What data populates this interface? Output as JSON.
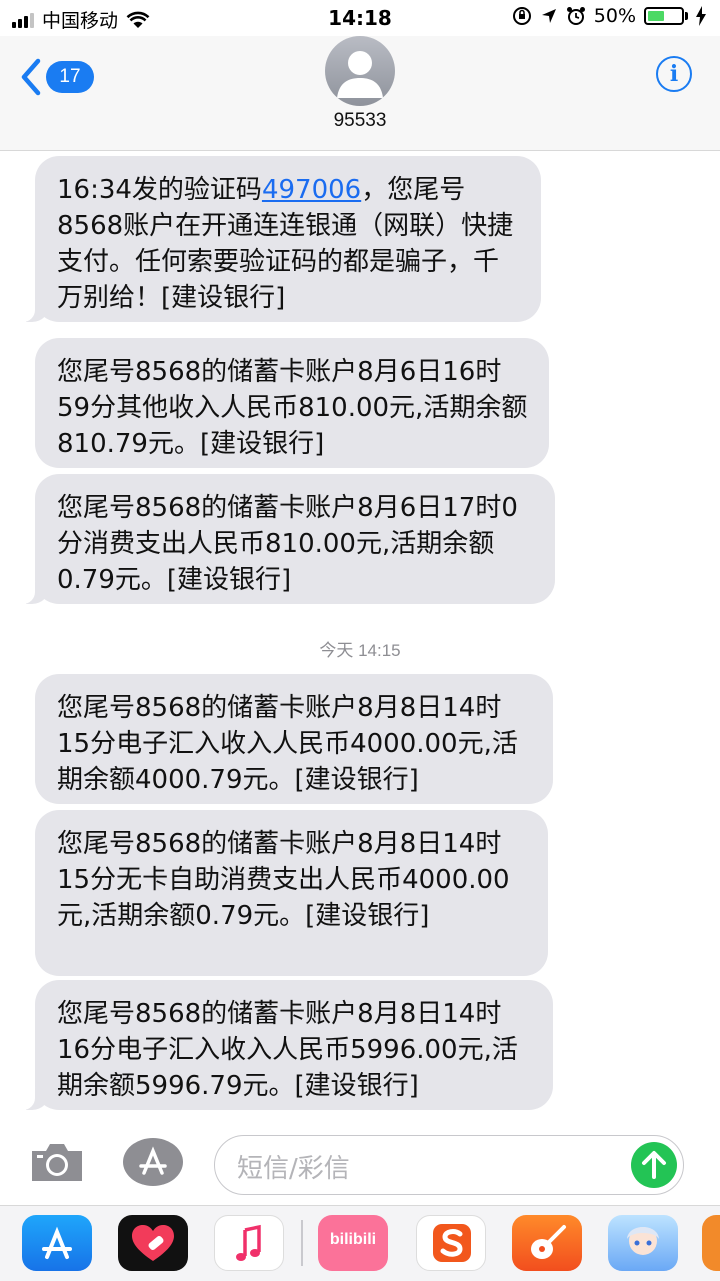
{
  "status_bar": {
    "carrier": "中国移动",
    "time": "14:18",
    "battery_percent": "50%",
    "battery_level": 0.5,
    "signal_bars": 3,
    "signal_total": 4
  },
  "header": {
    "back_count": "17",
    "contact_name": "95533",
    "info_label": "i"
  },
  "messages": [
    {
      "pre": "16:34发的验证码",
      "code": "497006",
      "post": "，您尾号8568账户在开通连连银通（网联）快捷支付。任何索要验证码的都是骗子，千万别给！[建设银行]"
    },
    {
      "text": "您尾号8568的储蓄卡账户8月6日16时59分其他收入人民币810.00元,活期余额810.79元。[建设银行]"
    },
    {
      "text": "您尾号8568的储蓄卡账户8月6日17时0分消费支出人民币810.00元,活期余额0.79元。[建设银行]"
    },
    {
      "text": "您尾号8568的储蓄卡账户8月8日14时15分电子汇入收入人民币4000.00元,活期余额4000.79元。[建设银行]"
    },
    {
      "text": "您尾号8568的储蓄卡账户8月8日14时15分无卡自助消费支出人民币4000.00元,活期余额0.79元。[建设银行]"
    },
    {
      "text": "您尾号8568的储蓄卡账户8月8日14时16分电子汇入收入人民币5996.00元,活期余额5996.79元。[建设银行]"
    }
  ],
  "timestamp_label": "今天 14:15",
  "input": {
    "placeholder": "短信/彩信"
  },
  "drawer_apps": [
    {
      "icon": "app-store-icon"
    },
    {
      "icon": "digital-touch-icon"
    },
    {
      "icon": "music-icon"
    },
    {
      "icon": "bilibili-icon",
      "label": "bilibili"
    },
    {
      "icon": "sogou-input-icon"
    },
    {
      "icon": "guitar-app-icon"
    },
    {
      "icon": "anime-game-icon"
    }
  ],
  "colors": {
    "accent": "#1a7cf2",
    "bubble": "#e5e5ea",
    "send": "#23c455",
    "battery": "#4cd964"
  }
}
